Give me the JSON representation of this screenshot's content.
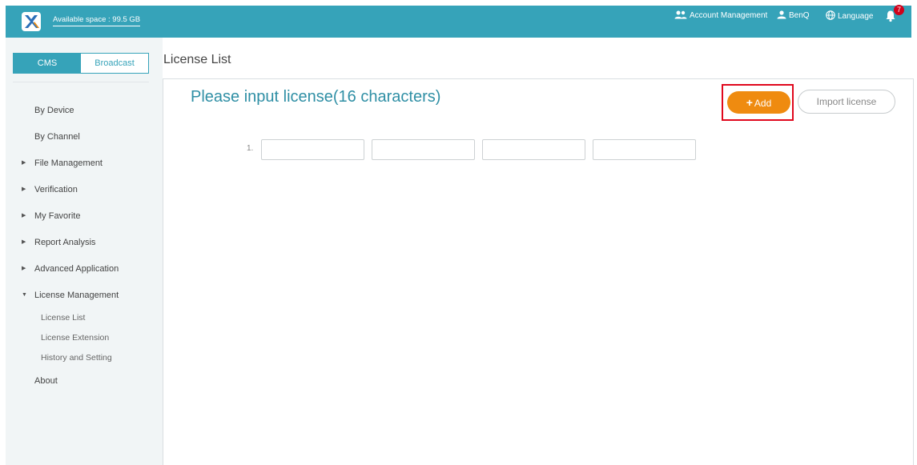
{
  "header": {
    "available_space": "Available space : 99.5 GB",
    "account_management": "Account Management",
    "user_name": "BenQ",
    "language": "Language",
    "notification_count": "7"
  },
  "sidebar": {
    "tabs": {
      "cms": "CMS",
      "broadcast": "Broadcast",
      "active": "CMS"
    },
    "items": [
      {
        "label": "By Device"
      },
      {
        "label": "By Channel"
      },
      {
        "label": "File Management"
      },
      {
        "label": "Verification"
      },
      {
        "label": "My Favorite"
      },
      {
        "label": "Report Analysis"
      },
      {
        "label": "Advanced Application"
      },
      {
        "label": "License Management"
      },
      {
        "label": "About"
      }
    ],
    "license_sub": [
      {
        "label": "License List"
      },
      {
        "label": "License Extension"
      },
      {
        "label": "History and Setting"
      }
    ]
  },
  "main": {
    "page_title": "License List",
    "heading": "Please input license(16 characters)",
    "add_label": "Add",
    "import_label": "Import license",
    "row_number": "1.",
    "inputs": [
      "",
      "",
      "",
      ""
    ]
  },
  "colors": {
    "primary": "#36a3b9",
    "accent": "#ef8b10",
    "highlight": "#e0081d",
    "badge": "#d0021b"
  },
  "icons": [
    "app-logo-icon",
    "users-icon",
    "user-icon",
    "globe-icon",
    "bell-icon",
    "plus-icon",
    "caret-right-icon",
    "caret-down-icon"
  ]
}
